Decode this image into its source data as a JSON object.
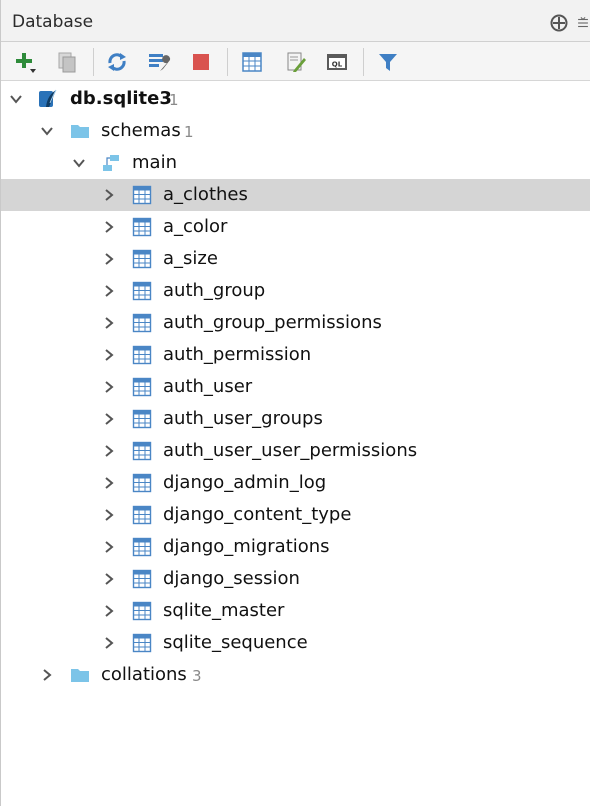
{
  "panel": {
    "title": "Database",
    "title_icons": [
      "crosshair-icon",
      "collapse-lines-icon"
    ]
  },
  "toolbar": {
    "buttons": [
      {
        "name": "add-icon",
        "color": "#2e8b3a"
      },
      {
        "name": "copy-icon",
        "color": "#9a9a9a"
      },
      {
        "name": "refresh-icon",
        "color": "#3f7fc4"
      },
      {
        "name": "wrench-icon",
        "color": "#3f7fc4"
      },
      {
        "name": "stop-icon",
        "color": "#d9534f"
      },
      {
        "name": "table-icon",
        "color": "#3f7fc4"
      },
      {
        "name": "edit-icon",
        "color": "#6a9f3a"
      },
      {
        "name": "console-ql-icon",
        "color": "#555555"
      },
      {
        "name": "filter-icon",
        "color": "#3f7fc4"
      }
    ]
  },
  "tree": {
    "datasource": {
      "label": "db.sqlite3",
      "count": "1"
    },
    "schemas": {
      "label": "schemas",
      "count": "1"
    },
    "main": {
      "label": "main"
    },
    "tables": [
      "a_clothes",
      "a_color",
      "a_size",
      "auth_group",
      "auth_group_permissions",
      "auth_permission",
      "auth_user",
      "auth_user_groups",
      "auth_user_user_permissions",
      "django_admin_log",
      "django_content_type",
      "django_migrations",
      "django_session",
      "sqlite_master",
      "sqlite_sequence"
    ],
    "collations": {
      "label": "collations",
      "count": "3"
    },
    "selected_table": "a_clothes"
  },
  "colors": {
    "selection": "#d5d5d5",
    "folder": "#7cc4e8",
    "table_icon": "#4a86c5",
    "count": "#8a8a8a"
  }
}
